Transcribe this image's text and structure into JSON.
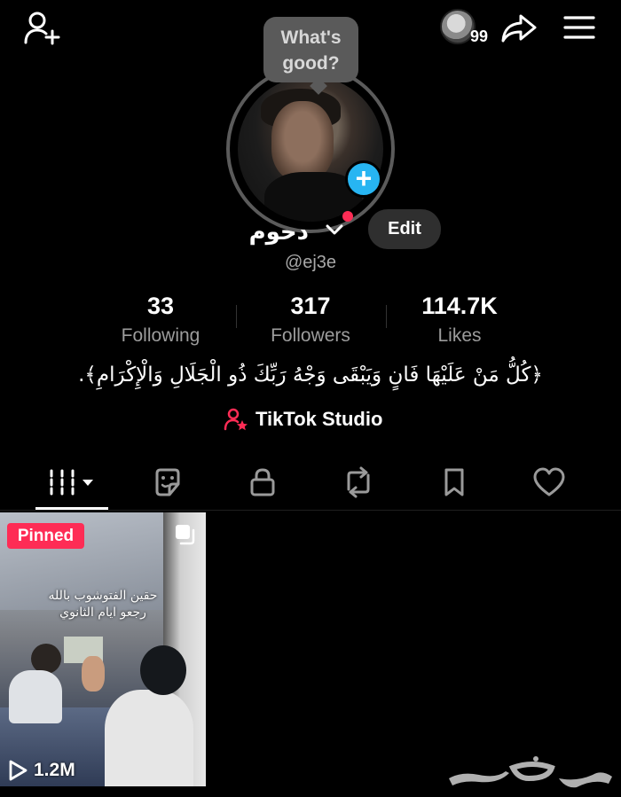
{
  "top_bar": {
    "add_friend_icon": "person-add-icon",
    "story_count": "99",
    "share_icon": "share-arrow-icon",
    "menu_icon": "hamburger-menu-icon"
  },
  "profile": {
    "bubble_text": "What's\ngood?",
    "display_name": "دحوم",
    "username": "@ej3e",
    "edit_label": "Edit",
    "add_photo_icon": "plus-icon"
  },
  "stats": [
    {
      "value": "33",
      "label": "Following"
    },
    {
      "value": "317",
      "label": "Followers"
    },
    {
      "value": "114.7K",
      "label": "Likes"
    }
  ],
  "bio": "﴿كُلُّ مَنْ عَلَيْهَا فَانٍ وَيَبْقَى وَجْهُ رَبِّكَ ذُو الْجَلَالِ وَالْإِكْرَامِ﴾.",
  "studio": {
    "label": "TikTok Studio",
    "icon": "person-star-icon",
    "accent": "#fe2c55"
  },
  "tabs": [
    {
      "name": "videos",
      "icon": "grid-icon",
      "active": true
    },
    {
      "name": "stickers",
      "icon": "sticker-icon"
    },
    {
      "name": "private",
      "icon": "lock-icon"
    },
    {
      "name": "reposts",
      "icon": "repost-icon"
    },
    {
      "name": "favorites",
      "icon": "bookmark-icon"
    },
    {
      "name": "liked",
      "icon": "heart-icon"
    }
  ],
  "videos": [
    {
      "pinned_label": "Pinned",
      "caption": "حقين الفتوشوب بالله\nرجعو ايام الثانوي",
      "views": "1.2M"
    }
  ],
  "colors": {
    "background": "#000000",
    "accent_red": "#fe2c55",
    "accent_blue": "#27b5f2",
    "secondary_text": "#9c9c9c"
  }
}
